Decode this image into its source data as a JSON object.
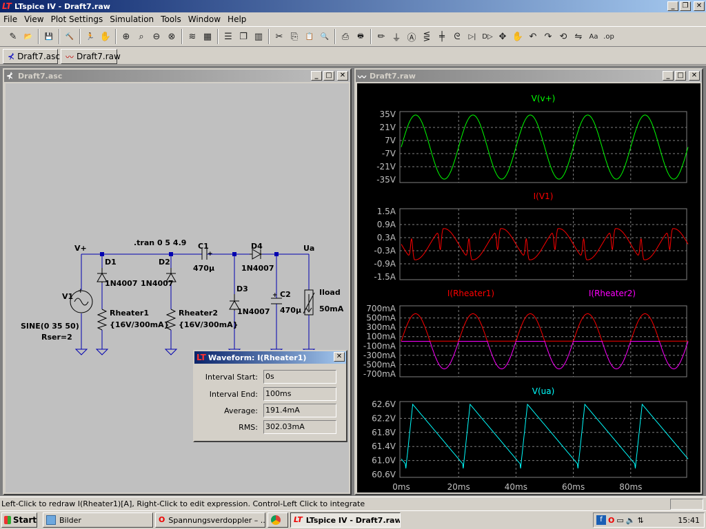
{
  "window": {
    "title": "LTspice IV - Draft7.raw",
    "buttons": [
      "_",
      "❐",
      "✕"
    ]
  },
  "menu": [
    "File",
    "View",
    "Plot Settings",
    "Simulation",
    "Tools",
    "Window",
    "Help"
  ],
  "toolbar": [
    "new-schematic-icon",
    "open-icon",
    "|",
    "save-icon",
    "|",
    "control-panel-icon",
    "|",
    "run-icon",
    "halt-icon",
    "|",
    "zoom-in-icon",
    "zoom-pan-icon",
    "zoom-out-icon",
    "zoom-cancel-icon",
    "|",
    "autorange-icon",
    "grid-icon",
    "|",
    "tile-horizontal-icon",
    "cascade-icon",
    "tile-vertical-icon",
    "|",
    "cut-icon",
    "copy-icon",
    "paste-icon",
    "find-icon",
    "|",
    "print-preview-icon",
    "print-icon",
    "|",
    "wire-icon",
    "ground-icon",
    "label-icon",
    "resistor-icon",
    "capacitor-icon",
    "inductor-icon",
    "diode-icon",
    "component-icon",
    "move-icon",
    "drag-icon",
    "undo-icon",
    "redo-icon",
    "rotate-icon",
    "mirror-icon",
    "text-icon",
    "spice-directive-icon"
  ],
  "tabs": [
    {
      "label": "Draft7.asc",
      "icon": "schematic-icon"
    },
    {
      "label": "Draft7.raw",
      "icon": "waveform-icon"
    }
  ],
  "schematic": {
    "title": "Draft7.asc",
    "directive": ".tran 0 5 4.9",
    "labels": {
      "vplus": "V+",
      "ua": "Ua",
      "v1": "V1",
      "v1_value": "SINE(0 35 50)",
      "v1_rser": "Rser=2",
      "d1": "D1",
      "d1_model": "1N4007",
      "d2": "D2",
      "d2_model": "1N4007",
      "d3": "D3",
      "d3_model": "1N4007",
      "d4": "D4",
      "d4_model": "1N4007",
      "c1": "C1",
      "c1_value": "470µ",
      "c1_plus": "+",
      "c2": "C2",
      "c2_value": "470µ",
      "c2_plus": "+",
      "r1": "Rheater1",
      "r1_value": "{16V/300mA}",
      "r2": "Rheater2",
      "r2_value": "{16V/300mA}",
      "iload": "Iload",
      "iload_value": "50mA"
    }
  },
  "plot": {
    "title": "Draft7.raw",
    "colors": {
      "green": "#00ff00",
      "red": "#ff0000",
      "magenta": "#ff00ff",
      "cyan": "#00ffff",
      "grid": "#808080",
      "text": "#c0c0c0"
    },
    "panes": [
      {
        "traces": [
          {
            "name": "V(v+)",
            "color": "#00ff00"
          }
        ],
        "yticks": [
          "35V",
          "21V",
          "7V",
          "-7V",
          "-21V",
          "-35V"
        ]
      },
      {
        "traces": [
          {
            "name": "I(V1)",
            "color": "#ff0000"
          }
        ],
        "yticks": [
          "1.5A",
          "0.9A",
          "0.3A",
          "-0.3A",
          "-0.9A",
          "-1.5A"
        ]
      },
      {
        "traces": [
          {
            "name": "I(Rheater1)",
            "color": "#ff0000"
          },
          {
            "name": "I(Rheater2)",
            "color": "#ff00ff"
          }
        ],
        "yticks": [
          "700mA",
          "500mA",
          "300mA",
          "100mA",
          "-100mA",
          "-300mA",
          "-500mA",
          "-700mA"
        ]
      },
      {
        "traces": [
          {
            "name": "V(ua)",
            "color": "#00ffff"
          }
        ],
        "yticks": [
          "62.6V",
          "62.2V",
          "61.8V",
          "61.4V",
          "61.0V",
          "60.6V"
        ]
      }
    ],
    "xticks": [
      "0ms",
      "20ms",
      "40ms",
      "60ms",
      "80ms"
    ]
  },
  "waveform_dialog": {
    "title": "Waveform: I(Rheater1)",
    "close": "✕",
    "rows": [
      {
        "label": "Interval Start:",
        "value": "0s"
      },
      {
        "label": "Interval End:",
        "value": "100ms"
      },
      {
        "label": "Average:",
        "value": "191.4mA"
      },
      {
        "label": "RMS:",
        "value": "302.03mA"
      }
    ]
  },
  "status": "Left-Click to redraw I(Rheater1)[A],  Right-Click to edit expression. Control-Left Click to integrate",
  "taskbar": {
    "start": "Start",
    "tasks": [
      {
        "label": "Bilder",
        "icon": "folder-icon"
      },
      {
        "label": "Spannungsverdoppler – ...",
        "icon": "opera-icon"
      },
      {
        "label": "",
        "icon": "chrome-icon"
      },
      {
        "label": "LTspice IV - Draft7.raw",
        "icon": "ltspice-icon"
      }
    ],
    "clock": "15:41"
  }
}
